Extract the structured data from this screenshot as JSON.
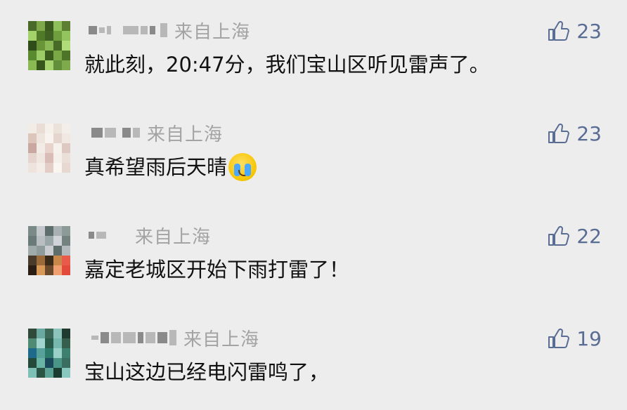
{
  "comments": [
    {
      "location": "来自上海",
      "text": "就此刻，20:47分，我们宝山区听见雷声了。",
      "likes": "23",
      "avatar_colors": [
        "#4a6a2a",
        "#7ea84a",
        "#3b5a1e",
        "#8fbf5a",
        "#5c7f32",
        "#a4d26a",
        "#507a28",
        "#3f6222",
        "#6e9e3e",
        "#94c45e",
        "#2f4d18",
        "#6a9438",
        "#89b855",
        "#476b26",
        "#b0dc7a",
        "#5a8a30",
        "#9ccc66",
        "#3a5c1c",
        "#7aa846",
        "#4e7428",
        "#8ab852",
        "#36561a",
        "#a8d470",
        "#62903a",
        "#7faa4c"
      ]
    },
    {
      "location": "来自上海",
      "text": "真希望雨后天晴",
      "emoji": "crying-face",
      "likes": "23",
      "avatar_colors": [
        "#f2ece6",
        "#e9ddd6",
        "#f6f0ea",
        "#ece2dc",
        "#f4eee8",
        "#dcc6bc",
        "#efe5df",
        "#f8f3ee",
        "#e4d6cf",
        "#f1e8e2",
        "#caa8a2",
        "#f3ebe5",
        "#e8d2cc",
        "#f7f1ec",
        "#ddc9c2",
        "#e6d4ce",
        "#f0e6e0",
        "#d9bcb5",
        "#f5efe9",
        "#ebdfd9",
        "#efe3dd",
        "#f4ede7",
        "#e2cec7",
        "#f9f5f1",
        "#e7d8d1"
      ]
    },
    {
      "location": "来自上海",
      "text": "嘉定老城区开始下雨打雷了！",
      "likes": "22",
      "avatar_colors": [
        "#7a8a86",
        "#c4c8cc",
        "#5e6e6c",
        "#a8b0b4",
        "#8c9a98",
        "#6a7a78",
        "#b8bec2",
        "#9aa6a8",
        "#d0d4d8",
        "#74827f",
        "#a0aaa9",
        "#8f9b9a",
        "#c9cdd1",
        "#606e6b",
        "#b2babd",
        "#4a3a2a",
        "#9a6a3a",
        "#3a2a1a",
        "#c8884a",
        "#e85a4a",
        "#2a1e14",
        "#d89858",
        "#6a4a2a",
        "#f0a070",
        "#e24a3c"
      ]
    },
    {
      "location": "来自上海",
      "text": "宝山这边已经电闪雷鸣了，",
      "likes": "19",
      "avatar_colors": [
        "#2f4a3a",
        "#6aa8a0",
        "#3d6a58",
        "#8cc4bc",
        "#1f3a2e",
        "#4e8a74",
        "#a0d4cc",
        "#2a5a48",
        "#76b8ae",
        "#355e4c",
        "#1e6a8a",
        "#58a09a",
        "#2c7a6a",
        "#9ad0c8",
        "#3e8070",
        "#244a3c",
        "#6ab4a6",
        "#1a4a5a",
        "#4a9488",
        "#3a6e60",
        "#7ec0b6",
        "#2a5444",
        "#5aa294",
        "#1c3e32",
        "#88c8be"
      ]
    }
  ],
  "icons": {
    "like": "thumbs-up-icon"
  },
  "colors": {
    "background": "#ededed",
    "likes": "#586c94",
    "location": "#a3a3a3"
  }
}
